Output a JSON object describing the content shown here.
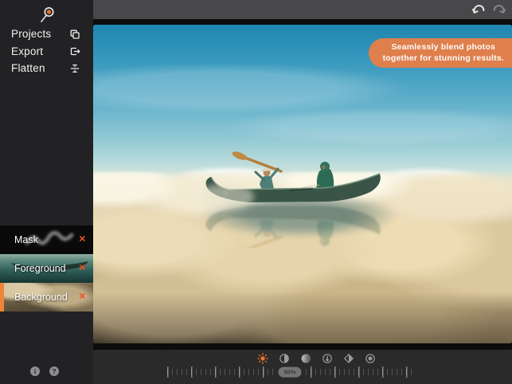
{
  "app": {
    "accent_orange": "#df7f4c",
    "delete_red": "#f4511e",
    "selected_bar_orange": "#f08538",
    "sun_orange": "#e8742c"
  },
  "sidebar": {
    "tool_icon": "loupe-search-icon",
    "menu": [
      {
        "label": "Projects",
        "icon": "projects-copy-icon"
      },
      {
        "label": "Export",
        "icon": "export-icon"
      },
      {
        "label": "Flatten",
        "icon": "flatten-icon"
      }
    ],
    "layers": [
      {
        "label": "Mask",
        "delete_glyph": "✕",
        "selected": false,
        "thumb": "mask-scribble-thumbnail"
      },
      {
        "label": "Foreground",
        "delete_glyph": "✕",
        "selected": false,
        "thumb": "canoe-photo-thumbnail"
      },
      {
        "label": "Background",
        "delete_glyph": "✕",
        "selected": true,
        "thumb": "clouds-photo-thumbnail"
      }
    ],
    "footer": {
      "info_glyph": "i",
      "help_glyph": "?"
    }
  },
  "topbar": {
    "undo_icon": "undo-arrow-icon",
    "redo_icon": "redo-arrow-icon"
  },
  "canvas": {
    "image_alt": "Two people paddling a canoe floating on a sea of clouds under a blue sky",
    "badge": {
      "line1": "Seamlessly blend photos",
      "line2": "together for stunning results.",
      "bg": "#df7f4c"
    }
  },
  "toolbar": {
    "adjust_icons": [
      "brightness",
      "contrast",
      "saturation",
      "temperature",
      "sharpness",
      "vignette"
    ],
    "active_icon": "brightness",
    "zoom_label": "50%"
  }
}
